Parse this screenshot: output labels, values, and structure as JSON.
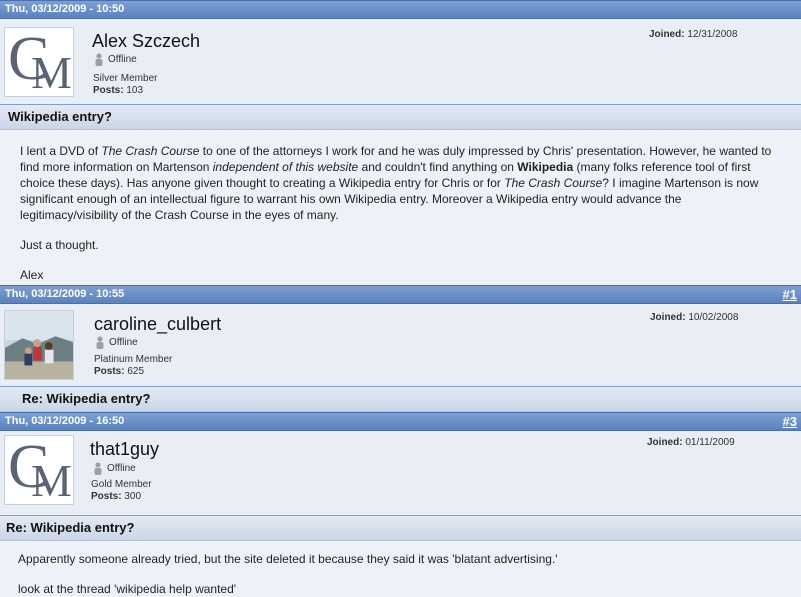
{
  "posts": [
    {
      "date": "Thu, 03/12/2009 - 10:50",
      "number": "",
      "avatar": "cm-logo",
      "username": "Alex Szczech",
      "status": "Offline",
      "rank": "Silver Member",
      "posts_label": "Posts:",
      "posts_count": "103",
      "joined_label": "Joined:",
      "joined_date": "12/31/2008",
      "subject": "Wikipedia entry?",
      "body": [
        [
          {
            "t": "I lent a DVD of "
          },
          {
            "t": "The Crash Course",
            "i": true
          },
          {
            "t": " to one of the attorneys I work for and he was duly impressed by Chris' presentation. However, he wanted to find more information on Martenson "
          },
          {
            "t": "independent of this website",
            "i": true
          },
          {
            "t": " and couldn't find anything on "
          },
          {
            "t": "Wikipedia",
            "b": true
          },
          {
            "t": " (many folks reference tool of first choice these days). Has anyone given thought to creating a Wikipedia entry for Chris or for "
          },
          {
            "t": "The Crash Course",
            "i": true
          },
          {
            "t": "? I imagine Martenson is now significant enough of an intellectual figure to warrant his own Wikipedia entry. Moreover a Wikipedia entry would advance the legitimacy/visibility of the Crash Course in the eyes of many."
          }
        ],
        [
          {
            "t": "Just a thought."
          }
        ],
        [
          {
            "t": "Alex"
          }
        ]
      ]
    },
    {
      "date": "Thu, 03/12/2009 - 10:55",
      "number": "#1",
      "avatar": "photo",
      "username": "caroline_culbert",
      "status": "Offline",
      "rank": "Platinum Member",
      "posts_label": "Posts:",
      "posts_count": "625",
      "joined_label": "Joined:",
      "joined_date": "10/02/2008",
      "subject": "Re: Wikipedia entry?",
      "body": []
    },
    {
      "date": "Thu, 03/12/2009 - 16:50",
      "number": "#3",
      "avatar": "cm-logo",
      "username": "that1guy",
      "status": "Offline",
      "rank": "Gold Member",
      "posts_label": "Posts:",
      "posts_count": "300",
      "joined_label": "Joined:",
      "joined_date": "01/11/2009",
      "subject": "Re: Wikipedia entry?",
      "body": [
        [
          {
            "t": "Apparently someone already tried, but the site deleted it because they said it was 'blatant advertising.'"
          }
        ],
        [
          {
            "t": "look at the thread 'wikipedia help wanted'"
          }
        ]
      ]
    }
  ],
  "logo_text": {
    "c": "C",
    "m": "M"
  },
  "colors": {
    "header_bar": "#5a82c0",
    "user_bg": "#e9eef6",
    "body_bg": "#eef2f8"
  }
}
